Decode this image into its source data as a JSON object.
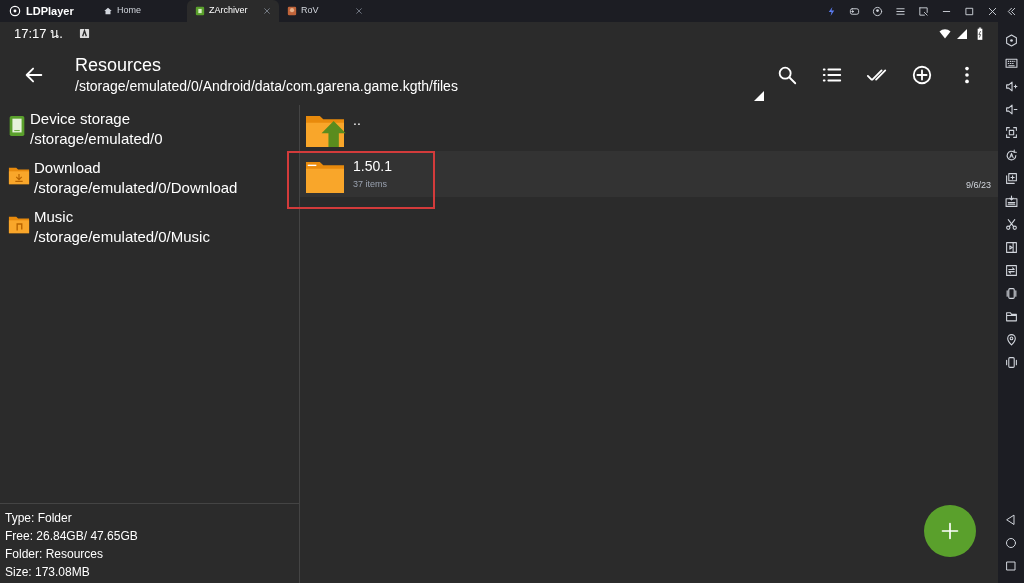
{
  "emulator": {
    "brand": "LDPlayer",
    "tabs": [
      {
        "label": "Home",
        "selected": false,
        "closable": false
      },
      {
        "label": "ZArchiver",
        "selected": true,
        "closable": true
      },
      {
        "label": "RoV",
        "selected": false,
        "closable": true
      }
    ]
  },
  "status_bar": {
    "time": "17:17 น."
  },
  "toolbar": {
    "title": "Resources",
    "path": "/storage/emulated/0/Android/data/com.garena.game.kgth/files"
  },
  "locations": [
    {
      "kind": "storage",
      "name": "Device storage",
      "path": "/storage/emulated/0"
    },
    {
      "kind": "download",
      "name": "Download",
      "path": "/storage/emulated/0/Download"
    },
    {
      "kind": "music",
      "name": "Music",
      "path": "/storage/emulated/0/Music"
    }
  ],
  "files": [
    {
      "kind": "parent",
      "name": "..",
      "selected": false,
      "annotated": false
    },
    {
      "kind": "folder",
      "name": "1.50.1",
      "info": "37 items",
      "date": "9/6/23",
      "selected": true,
      "annotated": true
    }
  ],
  "info": [
    "Type: Folder",
    "Free: 26.84GB/ 47.65GB",
    "Folder: Resources",
    "Size: 173.08MB"
  ]
}
